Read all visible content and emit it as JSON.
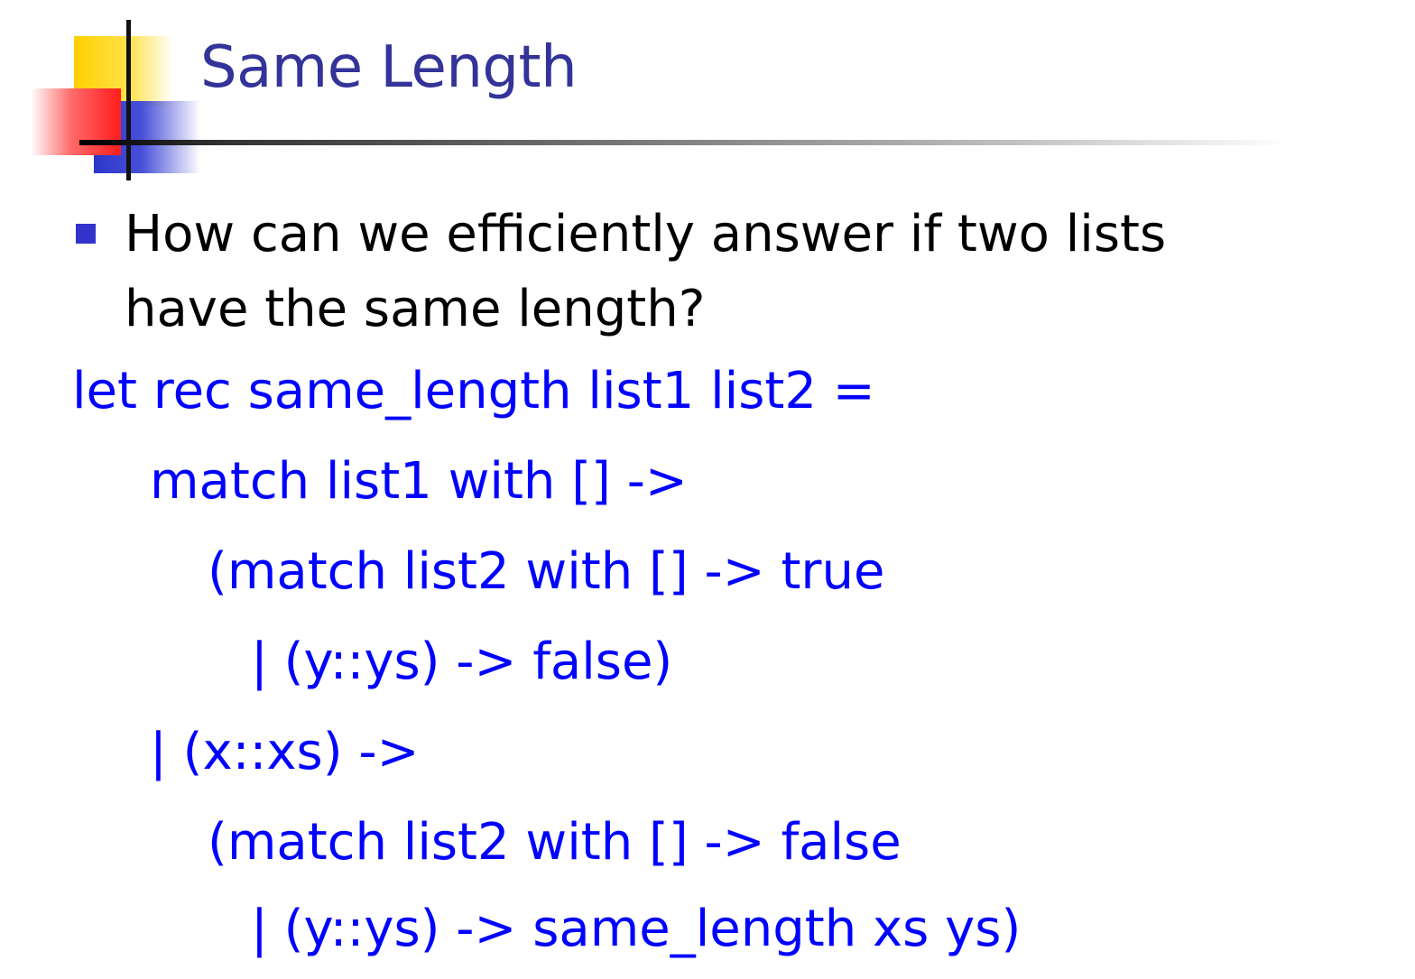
{
  "slide": {
    "title": "Same Length",
    "bullet": "How can we efficiently answer if two lists have the same length?",
    "code_lines": [
      "let rec same_length list1 list2 =",
      "match list1 with [] ->",
      "(match list2 with [] -> true",
      "| (y::ys) -> false)",
      "| (x::xs) ->",
      "(match list2 with [] -> false",
      "| (y::ys) -> same_length xs ys)"
    ]
  },
  "colors": {
    "title": "#333399",
    "code": "#0000ff",
    "bullet": "#3333cc",
    "text": "#000000"
  }
}
